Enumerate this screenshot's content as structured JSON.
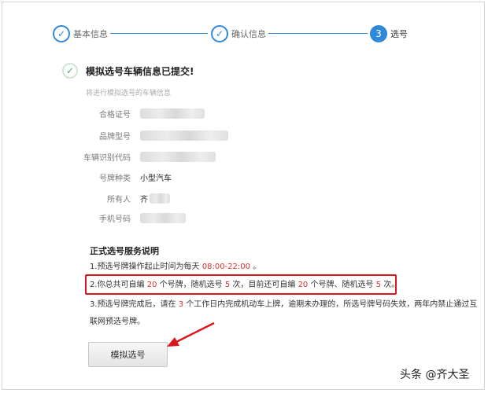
{
  "stepper": {
    "steps": [
      {
        "label": "基本信息",
        "mark": "✓"
      },
      {
        "label": "确认信息",
        "mark": "✓"
      },
      {
        "label": "选号",
        "mark": "3"
      }
    ],
    "accent": "#2f89d8"
  },
  "result": {
    "title": "模拟选号车辆信息已提交!",
    "subtitle": "将进行模拟选号的车辆信息",
    "icon": "check-icon"
  },
  "vehicle": {
    "rows": [
      {
        "label": "合格证号",
        "value": ""
      },
      {
        "label": "品牌型号",
        "value": ""
      },
      {
        "label": "车辆识别代码",
        "value": ""
      },
      {
        "label": "号牌种类",
        "value": "小型汽车"
      },
      {
        "label": "所有人",
        "value": "齐"
      },
      {
        "label": "手机号码",
        "value": ""
      }
    ]
  },
  "notes": {
    "title": "正式选号服务说明",
    "n1": {
      "a": "1.预选号牌操作起止时间为每天 ",
      "hl": "08:00-22:00",
      "b": " 。"
    },
    "n2": {
      "a": "2.你总共可自编 ",
      "h1": "20",
      "b": " 个号牌，随机选号 ",
      "h2": "5",
      "c": " 次，目前还可自编 ",
      "h3": "20",
      "d": " 个号牌、随机选号 ",
      "h4": "5",
      "e": " 次。"
    },
    "n3": {
      "a": "3.预选号牌完成后，请在 ",
      "hl": "3",
      "b": " 个工作日内完成机动车上牌，逾期未办理的，所选号牌号码失效，两年内禁止通过互联网预选号牌。"
    },
    "highlight_color": "#d9302b"
  },
  "button": {
    "label": "模拟选号"
  },
  "watermark": "头条 @齐大圣"
}
